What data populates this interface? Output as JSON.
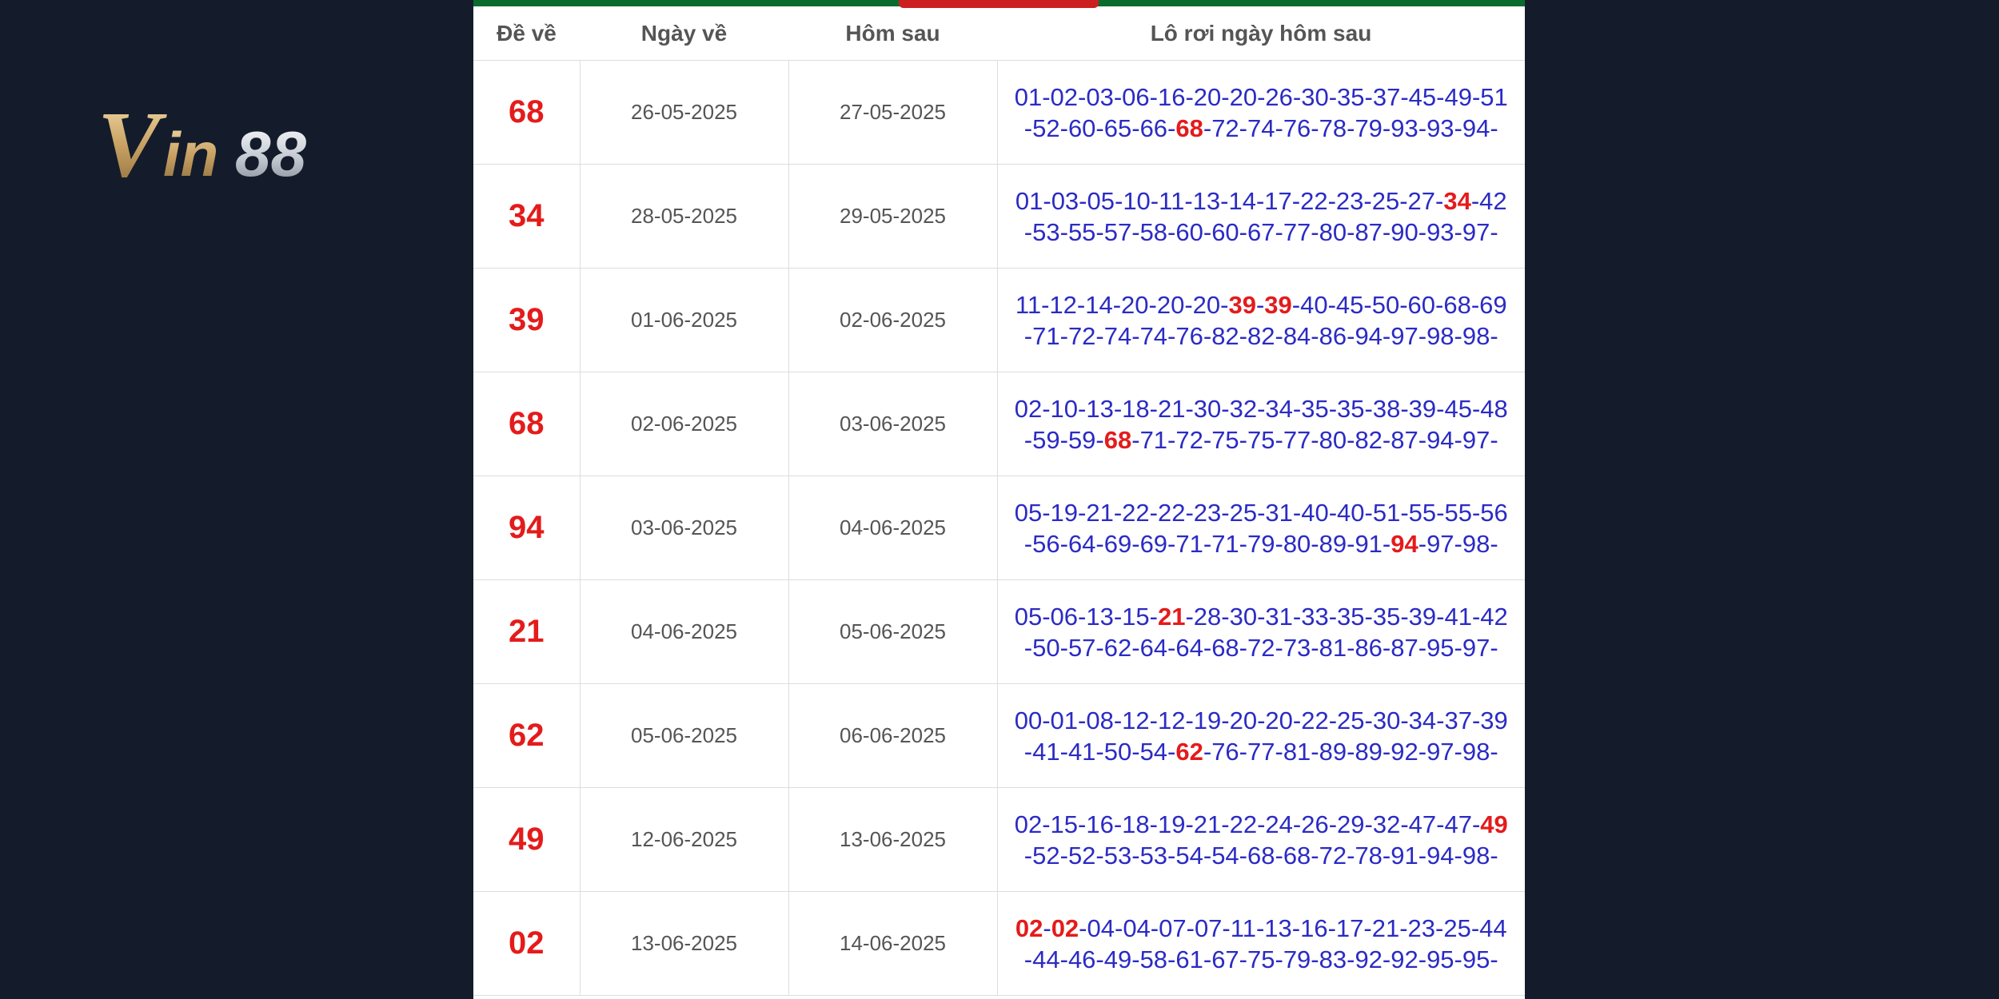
{
  "logo": {
    "text": "Vin88"
  },
  "table": {
    "headers": {
      "de_ve": "Đề về",
      "ngay_ve": "Ngày về",
      "hom_sau": "Hôm sau",
      "lo_roi": "Lô rơi ngày hôm sau"
    },
    "rows": [
      {
        "de": "68",
        "ngay_ve": "26-05-2025",
        "hom_sau": "27-05-2025",
        "lo": [
          "01",
          "02",
          "03",
          "06",
          "16",
          "20",
          "20",
          "26",
          "30",
          "35",
          "37",
          "45",
          "49",
          "51",
          "52",
          "60",
          "65",
          "66",
          "68",
          "72",
          "74",
          "76",
          "78",
          "79",
          "93",
          "93",
          "94"
        ],
        "hl": [
          18
        ]
      },
      {
        "de": "34",
        "ngay_ve": "28-05-2025",
        "hom_sau": "29-05-2025",
        "lo": [
          "01",
          "03",
          "05",
          "10",
          "11",
          "13",
          "14",
          "17",
          "22",
          "23",
          "25",
          "27",
          "34",
          "42",
          "53",
          "55",
          "57",
          "58",
          "60",
          "60",
          "67",
          "77",
          "80",
          "87",
          "90",
          "93",
          "97"
        ],
        "hl": [
          12
        ]
      },
      {
        "de": "39",
        "ngay_ve": "01-06-2025",
        "hom_sau": "02-06-2025",
        "lo": [
          "11",
          "12",
          "14",
          "20",
          "20",
          "20",
          "39",
          "39",
          "40",
          "45",
          "50",
          "60",
          "68",
          "69",
          "71",
          "72",
          "74",
          "74",
          "76",
          "82",
          "82",
          "84",
          "86",
          "94",
          "97",
          "98",
          "98"
        ],
        "hl": [
          6,
          7
        ]
      },
      {
        "de": "68",
        "ngay_ve": "02-06-2025",
        "hom_sau": "03-06-2025",
        "lo": [
          "02",
          "10",
          "13",
          "18",
          "21",
          "30",
          "32",
          "34",
          "35",
          "35",
          "38",
          "39",
          "45",
          "48",
          "59",
          "59",
          "68",
          "71",
          "72",
          "75",
          "75",
          "77",
          "80",
          "82",
          "87",
          "94",
          "97"
        ],
        "hl": [
          16
        ]
      },
      {
        "de": "94",
        "ngay_ve": "03-06-2025",
        "hom_sau": "04-06-2025",
        "lo": [
          "05",
          "19",
          "21",
          "22",
          "22",
          "23",
          "25",
          "31",
          "40",
          "40",
          "51",
          "55",
          "55",
          "56",
          "56",
          "64",
          "69",
          "69",
          "71",
          "71",
          "79",
          "80",
          "89",
          "91",
          "94",
          "97",
          "98"
        ],
        "hl": [
          24
        ]
      },
      {
        "de": "21",
        "ngay_ve": "04-06-2025",
        "hom_sau": "05-06-2025",
        "lo": [
          "05",
          "06",
          "13",
          "15",
          "21",
          "28",
          "30",
          "31",
          "33",
          "35",
          "35",
          "39",
          "41",
          "42",
          "50",
          "57",
          "62",
          "64",
          "64",
          "68",
          "72",
          "73",
          "81",
          "86",
          "87",
          "95",
          "97"
        ],
        "hl": [
          4
        ]
      },
      {
        "de": "62",
        "ngay_ve": "05-06-2025",
        "hom_sau": "06-06-2025",
        "lo": [
          "00",
          "01",
          "08",
          "12",
          "12",
          "19",
          "20",
          "20",
          "22",
          "25",
          "30",
          "34",
          "37",
          "39",
          "41",
          "41",
          "50",
          "54",
          "62",
          "76",
          "77",
          "81",
          "89",
          "89",
          "92",
          "97",
          "98"
        ],
        "hl": [
          18
        ]
      },
      {
        "de": "49",
        "ngay_ve": "12-06-2025",
        "hom_sau": "13-06-2025",
        "lo": [
          "02",
          "15",
          "16",
          "18",
          "19",
          "21",
          "22",
          "24",
          "26",
          "29",
          "32",
          "47",
          "47",
          "49",
          "52",
          "52",
          "53",
          "53",
          "54",
          "54",
          "68",
          "68",
          "72",
          "78",
          "91",
          "94",
          "98"
        ],
        "hl": [
          13
        ]
      },
      {
        "de": "02",
        "ngay_ve": "13-06-2025",
        "hom_sau": "14-06-2025",
        "lo": [
          "02",
          "02",
          "04",
          "04",
          "07",
          "07",
          "11",
          "13",
          "16",
          "17",
          "21",
          "23",
          "25",
          "44",
          "44",
          "46",
          "49",
          "58",
          "61",
          "67",
          "75",
          "79",
          "83",
          "92",
          "92",
          "95",
          "95"
        ],
        "hl": [
          0,
          1
        ]
      }
    ]
  },
  "colors": {
    "background": "#141c2b",
    "highlight": "#e41b1b",
    "number_blue": "#2b2bc4",
    "top_bar_green": "#0a6b2e"
  }
}
